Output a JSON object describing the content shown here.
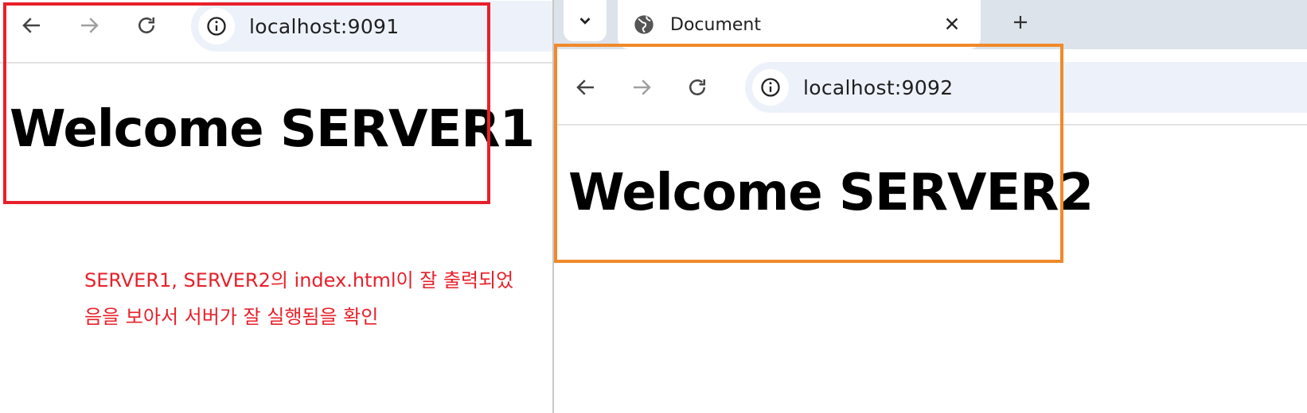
{
  "left_window": {
    "url": "localhost:9091",
    "heading": "Welcome SERVER1",
    "highlight_color": "#e8202a"
  },
  "right_window": {
    "tab_title": "Document",
    "url": "localhost:9092",
    "heading": "Welcome SERVER2",
    "highlight_color": "#f08a2a"
  },
  "annotation": {
    "line1": "SERVER1, SERVER2의 index.html이 잘 출력되었",
    "line2": "음을 보아서 서버가 잘 실행됨을 확인",
    "color": "#e8202a"
  },
  "icons": {
    "back": "arrow-left-icon",
    "forward": "arrow-right-icon",
    "reload": "reload-icon",
    "site_info": "info-circle-icon",
    "tab_search": "chevron-down-icon",
    "favicon": "globe-icon",
    "close": "close-icon",
    "new_tab": "plus-icon"
  }
}
